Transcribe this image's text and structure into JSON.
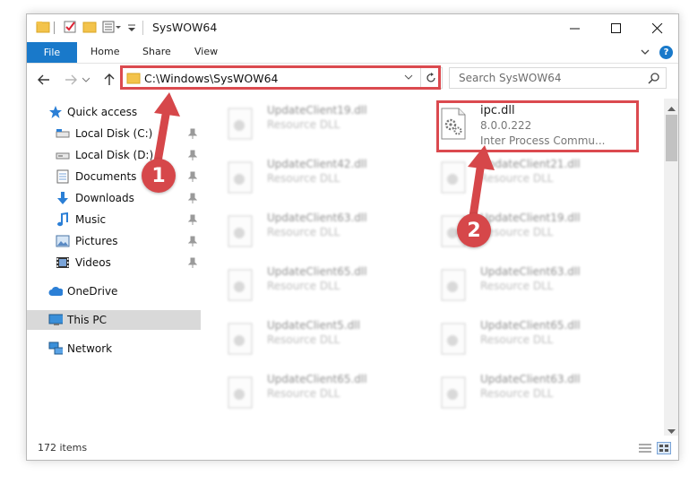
{
  "window": {
    "title": "SysWOW64",
    "ribbon_tabs": [
      "File",
      "Home",
      "Share",
      "View"
    ]
  },
  "nav": {
    "address": "C:\\Windows\\SysWOW64",
    "search_placeholder": "Search SysWOW64"
  },
  "sidebar": {
    "quick_access": "Quick access",
    "items": [
      {
        "label": "Local Disk (C:)",
        "icon": "drive-icon"
      },
      {
        "label": "Local Disk (D:)",
        "icon": "drive-icon"
      },
      {
        "label": "Documents",
        "icon": "documents-icon"
      },
      {
        "label": "Downloads",
        "icon": "downloads-icon"
      },
      {
        "label": "Music",
        "icon": "music-icon"
      },
      {
        "label": "Pictures",
        "icon": "pictures-icon"
      },
      {
        "label": "Videos",
        "icon": "videos-icon"
      }
    ],
    "onedrive": "OneDrive",
    "this_pc": "This PC",
    "network": "Network"
  },
  "files": {
    "highlighted": {
      "name": "ipc.dll",
      "version": "8.0.0.222",
      "description": "Inter Process Commu..."
    },
    "left_column": [
      {
        "name": "UpdateClient19.dll",
        "type": "Resource DLL"
      },
      {
        "name": "UpdateClient42.dll",
        "type": "Resource DLL"
      },
      {
        "name": "UpdateClient63.dll",
        "type": "Resource DLL"
      },
      {
        "name": "UpdateClient65.dll",
        "type": "Resource DLL"
      },
      {
        "name": "UpdateClient5.dll",
        "type": "Resource DLL"
      },
      {
        "name": "UpdateClient65.dll",
        "type": "Resource DLL"
      }
    ],
    "right_column": [
      {
        "name": "UpdateClient21.dll",
        "type": "Resource DLL"
      },
      {
        "name": "UpdateClient19.dll",
        "type": "Resource DLL"
      },
      {
        "name": "UpdateClient63.dll",
        "type": "Resource DLL"
      },
      {
        "name": "UpdateClient65.dll",
        "type": "Resource DLL"
      },
      {
        "name": "UpdateClient63.dll",
        "type": "Resource DLL"
      }
    ]
  },
  "status": {
    "item_count": "172 items"
  },
  "annotations": {
    "step1": "1",
    "step2": "2",
    "accent": "#db4a4f"
  },
  "colors": {
    "file_tab": "#1979ca",
    "selected": "#d9d9d9"
  }
}
